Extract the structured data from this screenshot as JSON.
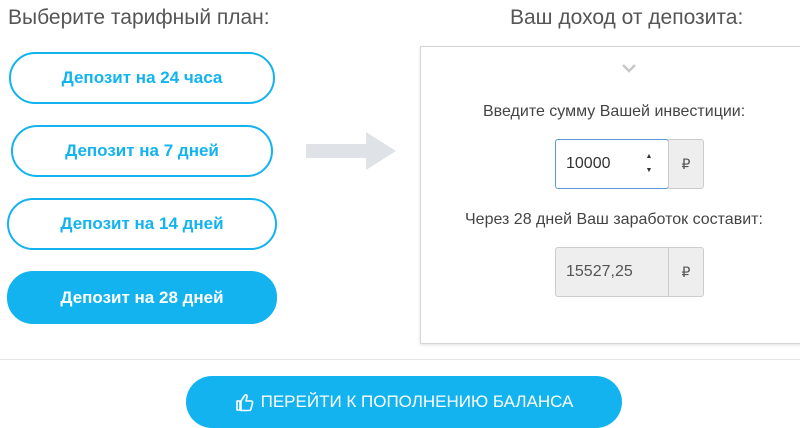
{
  "headings": {
    "plans": "Выберите тарифный план:",
    "income": "Ваш доход от депозита:"
  },
  "plans": [
    {
      "label": "Депозит на 24 часа",
      "active": false
    },
    {
      "label": "Депозит на 7 дней",
      "active": false
    },
    {
      "label": "Депозит на 14 дней",
      "active": false
    },
    {
      "label": "Депозит на 28 дней",
      "active": true
    }
  ],
  "calculator": {
    "invest_label": "Введите сумму Вашей инвестиции:",
    "invest_value": "10000",
    "currency": "₽",
    "earn_label": "Через 28 дней Ваш заработок составит:",
    "earn_value": "15527,25"
  },
  "cta": {
    "label": "ПЕРЕЙТИ К ПОПОЛНЕНИЮ БАЛАНСА",
    "icon": "thumbs-up-icon"
  },
  "colors": {
    "accent": "#12b3ef",
    "arrow": "#dfe2e6"
  }
}
